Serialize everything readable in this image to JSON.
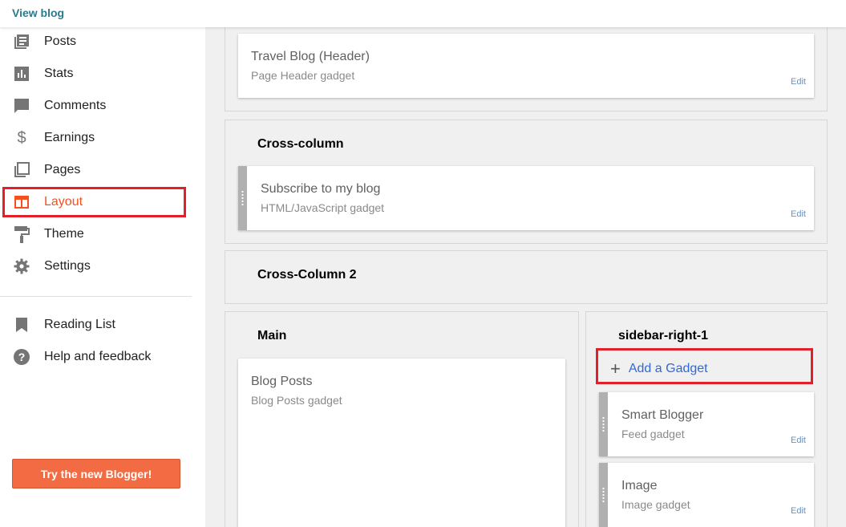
{
  "topbar": {
    "view_blog": "View blog"
  },
  "sidebar": {
    "items": [
      {
        "label": "Posts",
        "icon": "posts-icon"
      },
      {
        "label": "Stats",
        "icon": "stats-icon"
      },
      {
        "label": "Comments",
        "icon": "comments-icon"
      },
      {
        "label": "Earnings",
        "icon": "dollar-icon"
      },
      {
        "label": "Pages",
        "icon": "pages-icon"
      },
      {
        "label": "Layout",
        "icon": "layout-icon",
        "active": true
      },
      {
        "label": "Theme",
        "icon": "paint-roller-icon"
      },
      {
        "label": "Settings",
        "icon": "gear-icon"
      }
    ],
    "secondary": [
      {
        "label": "Reading List",
        "icon": "bookmark-icon"
      },
      {
        "label": "Help and feedback",
        "icon": "help-icon"
      }
    ],
    "try_button": "Try the new Blogger!"
  },
  "layout": {
    "header_gadget": {
      "title": "Travel Blog (Header)",
      "subtitle": "Page Header gadget",
      "edit": "Edit"
    },
    "cross_column": {
      "title": "Cross-column",
      "gadget": {
        "title": "Subscribe to my blog",
        "subtitle": "HTML/JavaScript gadget",
        "edit": "Edit"
      }
    },
    "cross_column_2": {
      "title": "Cross-Column 2"
    },
    "main": {
      "title": "Main",
      "gadget": {
        "title": "Blog Posts",
        "subtitle": "Blog Posts gadget"
      }
    },
    "sidebar_right": {
      "title": "sidebar-right-1",
      "add_gadget": "Add a Gadget",
      "gadgets": [
        {
          "title": "Smart Blogger",
          "subtitle": "Feed gadget",
          "edit": "Edit"
        },
        {
          "title": "Image",
          "subtitle": "Image gadget",
          "edit": "Edit"
        }
      ]
    }
  },
  "colors": {
    "accent": "#f4511e",
    "highlight": "#e3202a",
    "link": "#3367d6",
    "brand": "#2a7a8c"
  }
}
